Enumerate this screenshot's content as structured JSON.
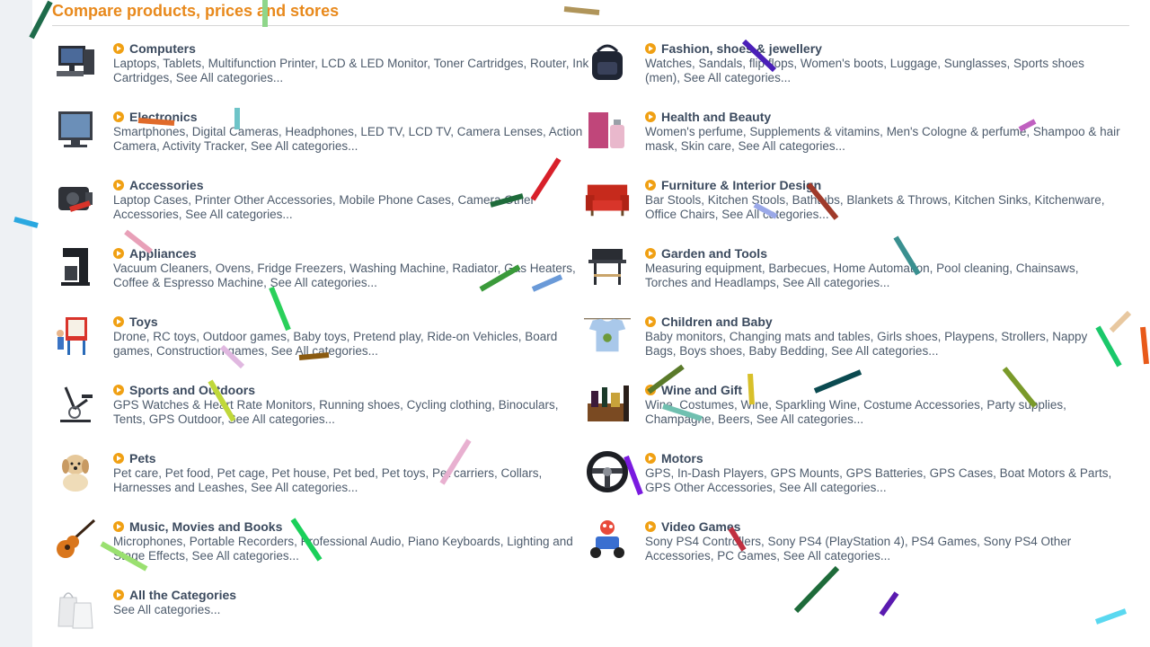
{
  "page": {
    "title": "Compare products, prices and stores"
  },
  "categories": [
    {
      "title": "Computers",
      "desc": "Laptops, Tablets, Multifunction Printer, LCD & LED Monitor, Toner Cartridges, Router, Ink Cartridges, See All categories...",
      "icon": "computer-icon"
    },
    {
      "title": "Fashion, shoes & jewellery",
      "desc": "Watches, Sandals, flip flops, Women's boots, Luggage, Sunglasses, Sports shoes (men), See All categories...",
      "icon": "backpack-icon"
    },
    {
      "title": "Electronics",
      "desc": "Smartphones, Digital Cameras, Headphones, LED TV, LCD TV, Camera Lenses, Action Camera, Activity Tracker, See All categories...",
      "icon": "tv-icon"
    },
    {
      "title": "Health and Beauty",
      "desc": "Women's perfume, Supplements & vitamins, Men's Cologne & perfume, Shampoo & hair mask, Skin care, See All categories...",
      "icon": "perfume-icon"
    },
    {
      "title": "Accessories",
      "desc": "Laptop Cases, Printer Other Accessories, Mobile Phone Cases, Camera Other Accessories, See All categories...",
      "icon": "camera-bag-icon"
    },
    {
      "title": "Furniture & Interior Design",
      "desc": "Bar Stools, Kitchen Stools, Bathtubs, Blankets & Throws, Kitchen Sinks, Kitchenware, Office Chairs, See All categories...",
      "icon": "armchair-icon"
    },
    {
      "title": "Appliances",
      "desc": "Vacuum Cleaners, Ovens, Fridge Freezers, Washing Machine, Radiator, Gas Heaters, Coffee & Espresso Machine, See All categories...",
      "icon": "coffee-maker-icon"
    },
    {
      "title": "Garden and Tools",
      "desc": "Measuring equipment, Barbecues, Home Automation, Pool cleaning, Chainsaws, Torches and Headlamps, See All categories...",
      "icon": "barbecue-icon"
    },
    {
      "title": "Toys",
      "desc": "Drone, RC toys, Outdoor games, Baby toys, Pretend play, Ride-on Vehicles, Board games, Construction games, See All categories...",
      "icon": "toy-easel-icon"
    },
    {
      "title": "Children and Baby",
      "desc": "Baby monitors, Changing mats and tables, Girls shoes, Playpens, Strollers, Nappy Bags, Boys shoes, Baby Bedding, See All categories...",
      "icon": "baby-shirt-icon"
    },
    {
      "title": "Sports and Outdoors",
      "desc": "GPS Watches & Heart Rate Monitors, Running shoes, Cycling clothing, Binoculars, Tents, GPS Outdoor, See All categories...",
      "icon": "exercise-bike-icon"
    },
    {
      "title": "Wine and Gift",
      "desc": "Wine, Costumes, Wine, Sparkling Wine, Costume Accessories, Party supplies, Champagne, Beers, See All categories...",
      "icon": "gift-basket-icon"
    },
    {
      "title": "Pets",
      "desc": "Pet care, Pet food, Pet cage, Pet house, Pet bed, Pet toys, Pet carriers, Collars, Harnesses and Leashes, See All categories...",
      "icon": "puppy-icon"
    },
    {
      "title": "Motors",
      "desc": "GPS, In-Dash Players, GPS Mounts, GPS Batteries, GPS Cases, Boat Motors & Parts, GPS Other Accessories, See All categories...",
      "icon": "steering-wheel-icon"
    },
    {
      "title": "Music, Movies and Books",
      "desc": "Microphones, Portable Recorders, Professional Audio, Piano Keyboards, Lighting and Stage Effects, See All categories...",
      "icon": "guitar-icon"
    },
    {
      "title": "Video Games",
      "desc": "Sony PS4 Controllers, Sony PS4 (PlayStation 4), PS4 Games, Sony PS4 Other Accessories, PC Games, See All categories...",
      "icon": "kart-racer-icon"
    },
    {
      "title": "All the Categories",
      "desc": "See All categories...",
      "icon": "shopping-bags-icon"
    }
  ],
  "colors": {
    "title": "#e8891c",
    "bullet": "#f0a013",
    "heading": "#3b4a5e",
    "text": "#4d5b6c"
  }
}
